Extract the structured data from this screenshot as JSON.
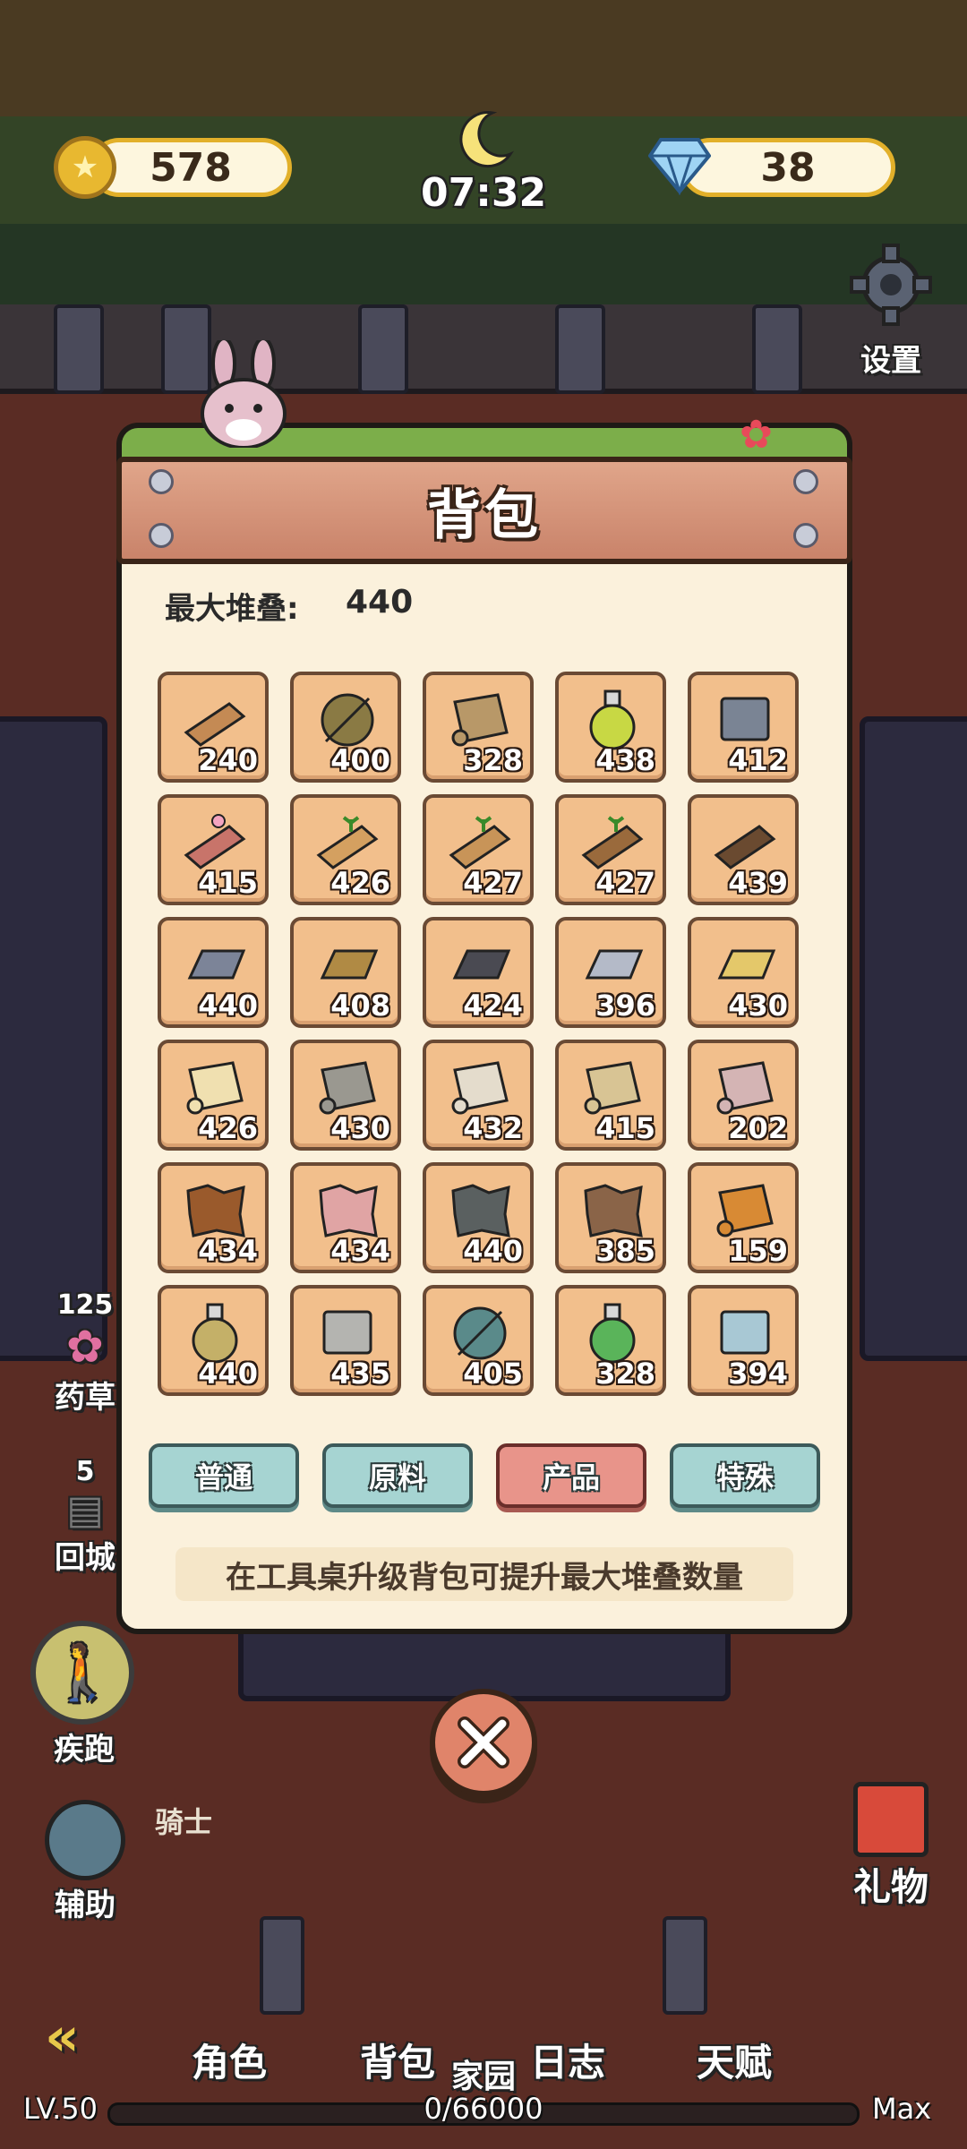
{
  "hud": {
    "coins": "578",
    "time": "07:32",
    "diamonds": "38",
    "settings_label": "设置"
  },
  "side": {
    "herb_count": "125",
    "herb_label": "药草",
    "recall_count": "5",
    "recall_label": "回城",
    "sprint_label": "疾跑",
    "assist_label": "辅助",
    "knight_label": "骑士",
    "gift_label": "礼物"
  },
  "backpack": {
    "title": "背包",
    "max_stack_label": "最大堆叠:",
    "max_stack_value": "440",
    "items": [
      {
        "icon": "wood-plank-icon",
        "count": "240"
      },
      {
        "icon": "yarn-ball-icon",
        "count": "400"
      },
      {
        "icon": "scroll-icon",
        "count": "328"
      },
      {
        "icon": "potion-flask-icon",
        "count": "438"
      },
      {
        "icon": "metal-cube-icon",
        "count": "412"
      },
      {
        "icon": "pink-plank-icon",
        "count": "415"
      },
      {
        "icon": "sprout-plank-icon",
        "count": "426"
      },
      {
        "icon": "seedling-plank-icon",
        "count": "427"
      },
      {
        "icon": "dark-sprout-plank-icon",
        "count": "427"
      },
      {
        "icon": "ebony-plank-icon",
        "count": "439"
      },
      {
        "icon": "iron-ingot-icon",
        "count": "440"
      },
      {
        "icon": "bronze-ingot-icon",
        "count": "408"
      },
      {
        "icon": "dark-ingot-icon",
        "count": "424"
      },
      {
        "icon": "silver-ingot-icon",
        "count": "396"
      },
      {
        "icon": "gold-ingot-icon",
        "count": "430"
      },
      {
        "icon": "gold-cloth-icon",
        "count": "426"
      },
      {
        "icon": "gray-cloth-icon",
        "count": "430"
      },
      {
        "icon": "white-cloth-icon",
        "count": "432"
      },
      {
        "icon": "tan-cloth-icon",
        "count": "415"
      },
      {
        "icon": "red-striped-cloth-icon",
        "count": "202"
      },
      {
        "icon": "spotted-hide-icon",
        "count": "434"
      },
      {
        "icon": "pink-hide-icon",
        "count": "434"
      },
      {
        "icon": "gray-hide-icon",
        "count": "440"
      },
      {
        "icon": "brown-hide-icon",
        "count": "385"
      },
      {
        "icon": "orange-scroll-icon",
        "count": "159"
      },
      {
        "icon": "seed-jar-icon",
        "count": "440"
      },
      {
        "icon": "stone-brick-icon",
        "count": "435"
      },
      {
        "icon": "compass-disc-icon",
        "count": "405"
      },
      {
        "icon": "green-potion-icon",
        "count": "328"
      },
      {
        "icon": "glass-pane-icon",
        "count": "394"
      }
    ],
    "tabs": [
      {
        "label": "普通",
        "active": false
      },
      {
        "label": "原料",
        "active": false
      },
      {
        "label": "产品",
        "active": true
      },
      {
        "label": "特殊",
        "active": false
      }
    ],
    "hint": "在工具桌升级背包可提升最大堆叠数量"
  },
  "nav": {
    "role": "角色",
    "backpack": "背包",
    "home": "家园",
    "journal": "日志",
    "talent": "天赋",
    "level": "LV.50",
    "xp": "0/66000",
    "max": "Max"
  },
  "colors": {
    "slot_bg": "#f2bf8c",
    "tab_blue": "#a6d4d2",
    "tab_active": "#e8948a",
    "panel_bg": "#fbf1dc"
  }
}
